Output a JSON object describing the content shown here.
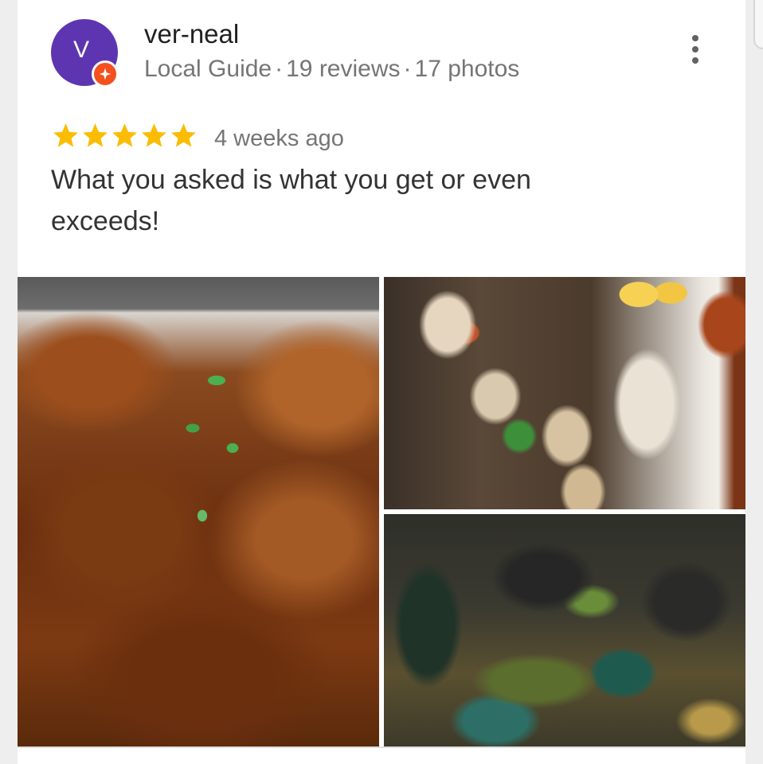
{
  "review": {
    "avatar_initial": "V",
    "reviewer_name": "ver-neal",
    "reviewer_type": "Local Guide",
    "reviews_count": "19 reviews",
    "photos_count": "17 photos",
    "separator": "·",
    "rating": 5,
    "rating_max": 5,
    "time_ago": "4 weeks ago",
    "text": "What you asked is what you get or even exceeds!"
  },
  "photos": [
    {
      "icon": "photo-spicy-prawns"
    },
    {
      "icon": "photo-grilled-squid"
    },
    {
      "icon": "photo-green-mussels"
    }
  ],
  "colors": {
    "avatar_bg": "#5e35b1",
    "badge_bg": "#f4511e",
    "star": "#fbbc04",
    "name_text": "#212121",
    "meta_text": "#757575"
  },
  "icons": {
    "more": "more-vert-icon",
    "badge": "local-guide-badge-icon",
    "star": "star-icon"
  }
}
